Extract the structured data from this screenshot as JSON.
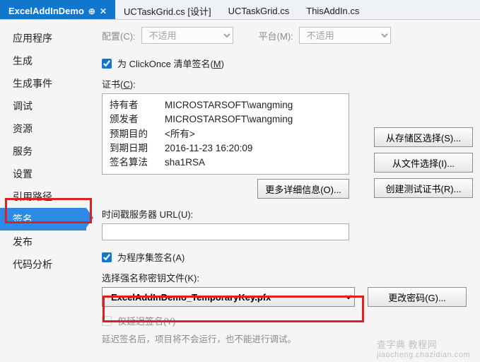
{
  "tabs": {
    "t0": "ExcelAddInDemo",
    "t1": "UCTaskGrid.cs [设计]",
    "t2": "UCTaskGrid.cs",
    "t3": "ThisAddIn.cs"
  },
  "sidebar": {
    "s0": "应用程序",
    "s1": "生成",
    "s2": "生成事件",
    "s3": "调试",
    "s4": "资源",
    "s5": "服务",
    "s6": "设置",
    "s7": "引用路径",
    "s8": "签名",
    "s9": "发布",
    "s10": "代码分析"
  },
  "top": {
    "config_label": "配置(C):",
    "config_value": "不适用",
    "platform_label": "平台(M):",
    "platform_value": "不适用"
  },
  "clickonce": {
    "checkbox_label_prefix": "为 ClickOnce 清单签名(",
    "checkbox_label_u": "M",
    "checkbox_label_suffix": ")"
  },
  "cert": {
    "section_label_prefix": "证书(",
    "section_label_u": "C",
    "section_label_suffix": "):",
    "holder_k": "持有者",
    "holder_v": "MICROSTARSOFT\\wangming",
    "issuer_k": "颁发者",
    "issuer_v": "MICROSTARSOFT\\wangming",
    "purpose_k": "预期目的",
    "purpose_v": "<所有>",
    "expire_k": "到期日期",
    "expire_v": "2016-11-23 16:20:09",
    "algo_k": "签名算法",
    "algo_v": "sha1RSA"
  },
  "btns": {
    "from_store": "从存储区选择(S)...",
    "from_file": "从文件选择(I)...",
    "create_test": "创建测试证书(R)...",
    "more_detail": "更多详细信息(O)...",
    "change_pw": "更改密码(G)..."
  },
  "ts_label": "时间戳服务器 URL(U):",
  "asm": {
    "checkbox_label": "为程序集签名(A)",
    "key_label": "选择强名称密钥文件(K):",
    "key_value": "ExcelAddInDemo_TemporaryKey.pfx",
    "delay_label": "仅延迟签名(Y)",
    "delay_hint": "延迟签名后，项目将不会运行，也不能进行调试。"
  },
  "watermark": {
    "l1": "查字典 教程网",
    "l2": "jiaocheng.chazidian.com"
  }
}
